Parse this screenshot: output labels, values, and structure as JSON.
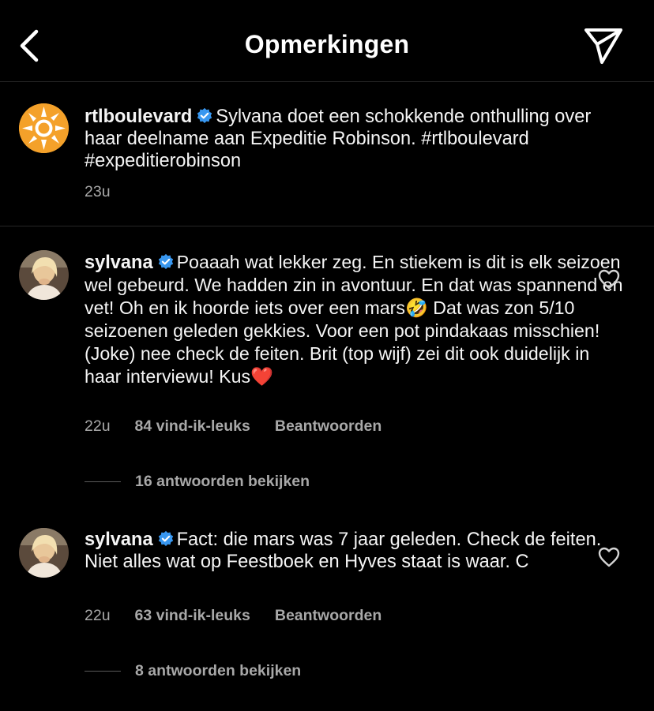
{
  "header": {
    "title": "Opmerkingen",
    "back_icon": "chevron-left-icon",
    "send_icon": "paper-plane-icon"
  },
  "caption": {
    "username": "rtlboulevard",
    "text": "Sylvana doet een schokkende onthulling over haar deelname aan Expeditie Robinson. #rtlboulevard #expeditierobinson",
    "time": "23u"
  },
  "comments": [
    {
      "username": "sylvana",
      "text": "Poaaah  wat lekker zeg. En stiekem is dit is elk seizoen wel gebeurd. We hadden zin in avontuur. En dat was spannend en vet! Oh en ik hoorde iets over een mars🤣 Dat was zon 5/10 seizoenen geleden gekkies. Voor een pot pindakaas misschien! (Joke) nee check de feiten. Brit (top wijf) zei dit ook duidelijk in haar interviewu! Kus❤️",
      "time": "22u",
      "likes": "84 vind-ik-leuks",
      "reply": "Beantwoorden",
      "view_replies": "16 antwoorden bekijken"
    },
    {
      "username": "sylvana",
      "text": "Fact: die mars was 7 jaar geleden. Check de feiten. Niet alles wat op Feestboek en Hyves staat is waar. C",
      "time": "22u",
      "likes": "63 vind-ik-leuks",
      "reply": "Beantwoorden",
      "view_replies": "8 antwoorden bekijken"
    }
  ],
  "colors": {
    "background": "#000000",
    "verified": "#3897f0",
    "secondary_text": "#a8a8a8",
    "logo_orange": "#f4a12a"
  }
}
